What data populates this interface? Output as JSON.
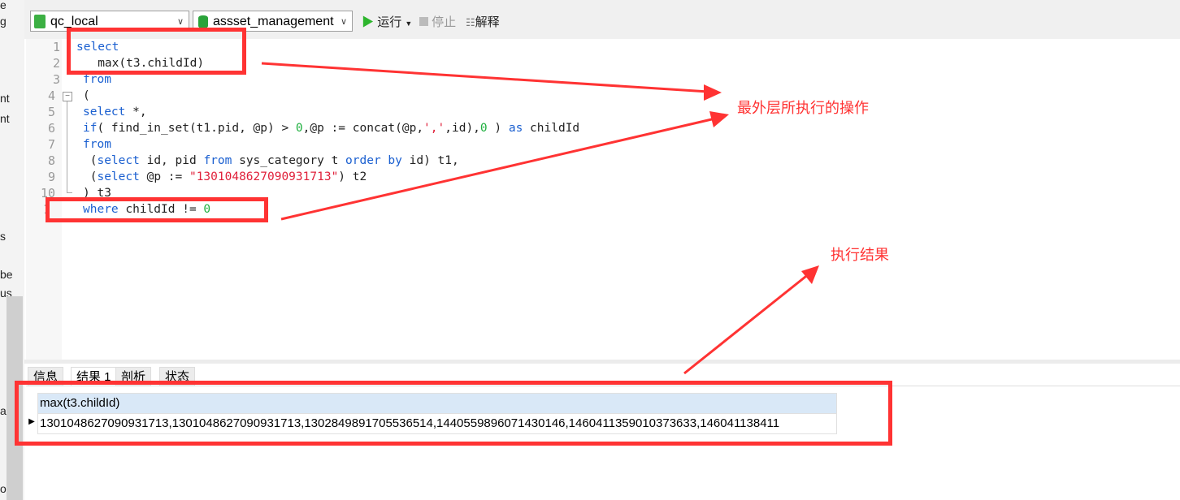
{
  "toolbar": {
    "connection": "qc_local",
    "database": "assset_management",
    "run": "运行",
    "stop": "停止",
    "explain": "解释"
  },
  "editor": {
    "lines": [
      {
        "n": "1"
      },
      {
        "n": "2"
      },
      {
        "n": "3"
      },
      {
        "n": "4"
      },
      {
        "n": "5"
      },
      {
        "n": "6"
      },
      {
        "n": "7"
      },
      {
        "n": "8"
      },
      {
        "n": "9"
      },
      {
        "n": "10"
      },
      {
        "n": "1"
      }
    ],
    "string_literal": "\"1301048627090931713\""
  },
  "result_tabs": [
    "信息",
    "结果 1",
    "剖析",
    "状态"
  ],
  "result": {
    "column": "max(t3.childId)",
    "value": "1301048627090931713,1301048627090931713,1302849891705536514,1440559896071430146,1460411359010373633,146041138411"
  },
  "annotations": {
    "outer_op": "最外层所执行的操作",
    "result": "执行结果",
    "color": "#ff3333"
  },
  "left_fragments": [
    "e",
    "g",
    "nt",
    "nt",
    "s",
    "be",
    "us",
    "a",
    "o"
  ]
}
